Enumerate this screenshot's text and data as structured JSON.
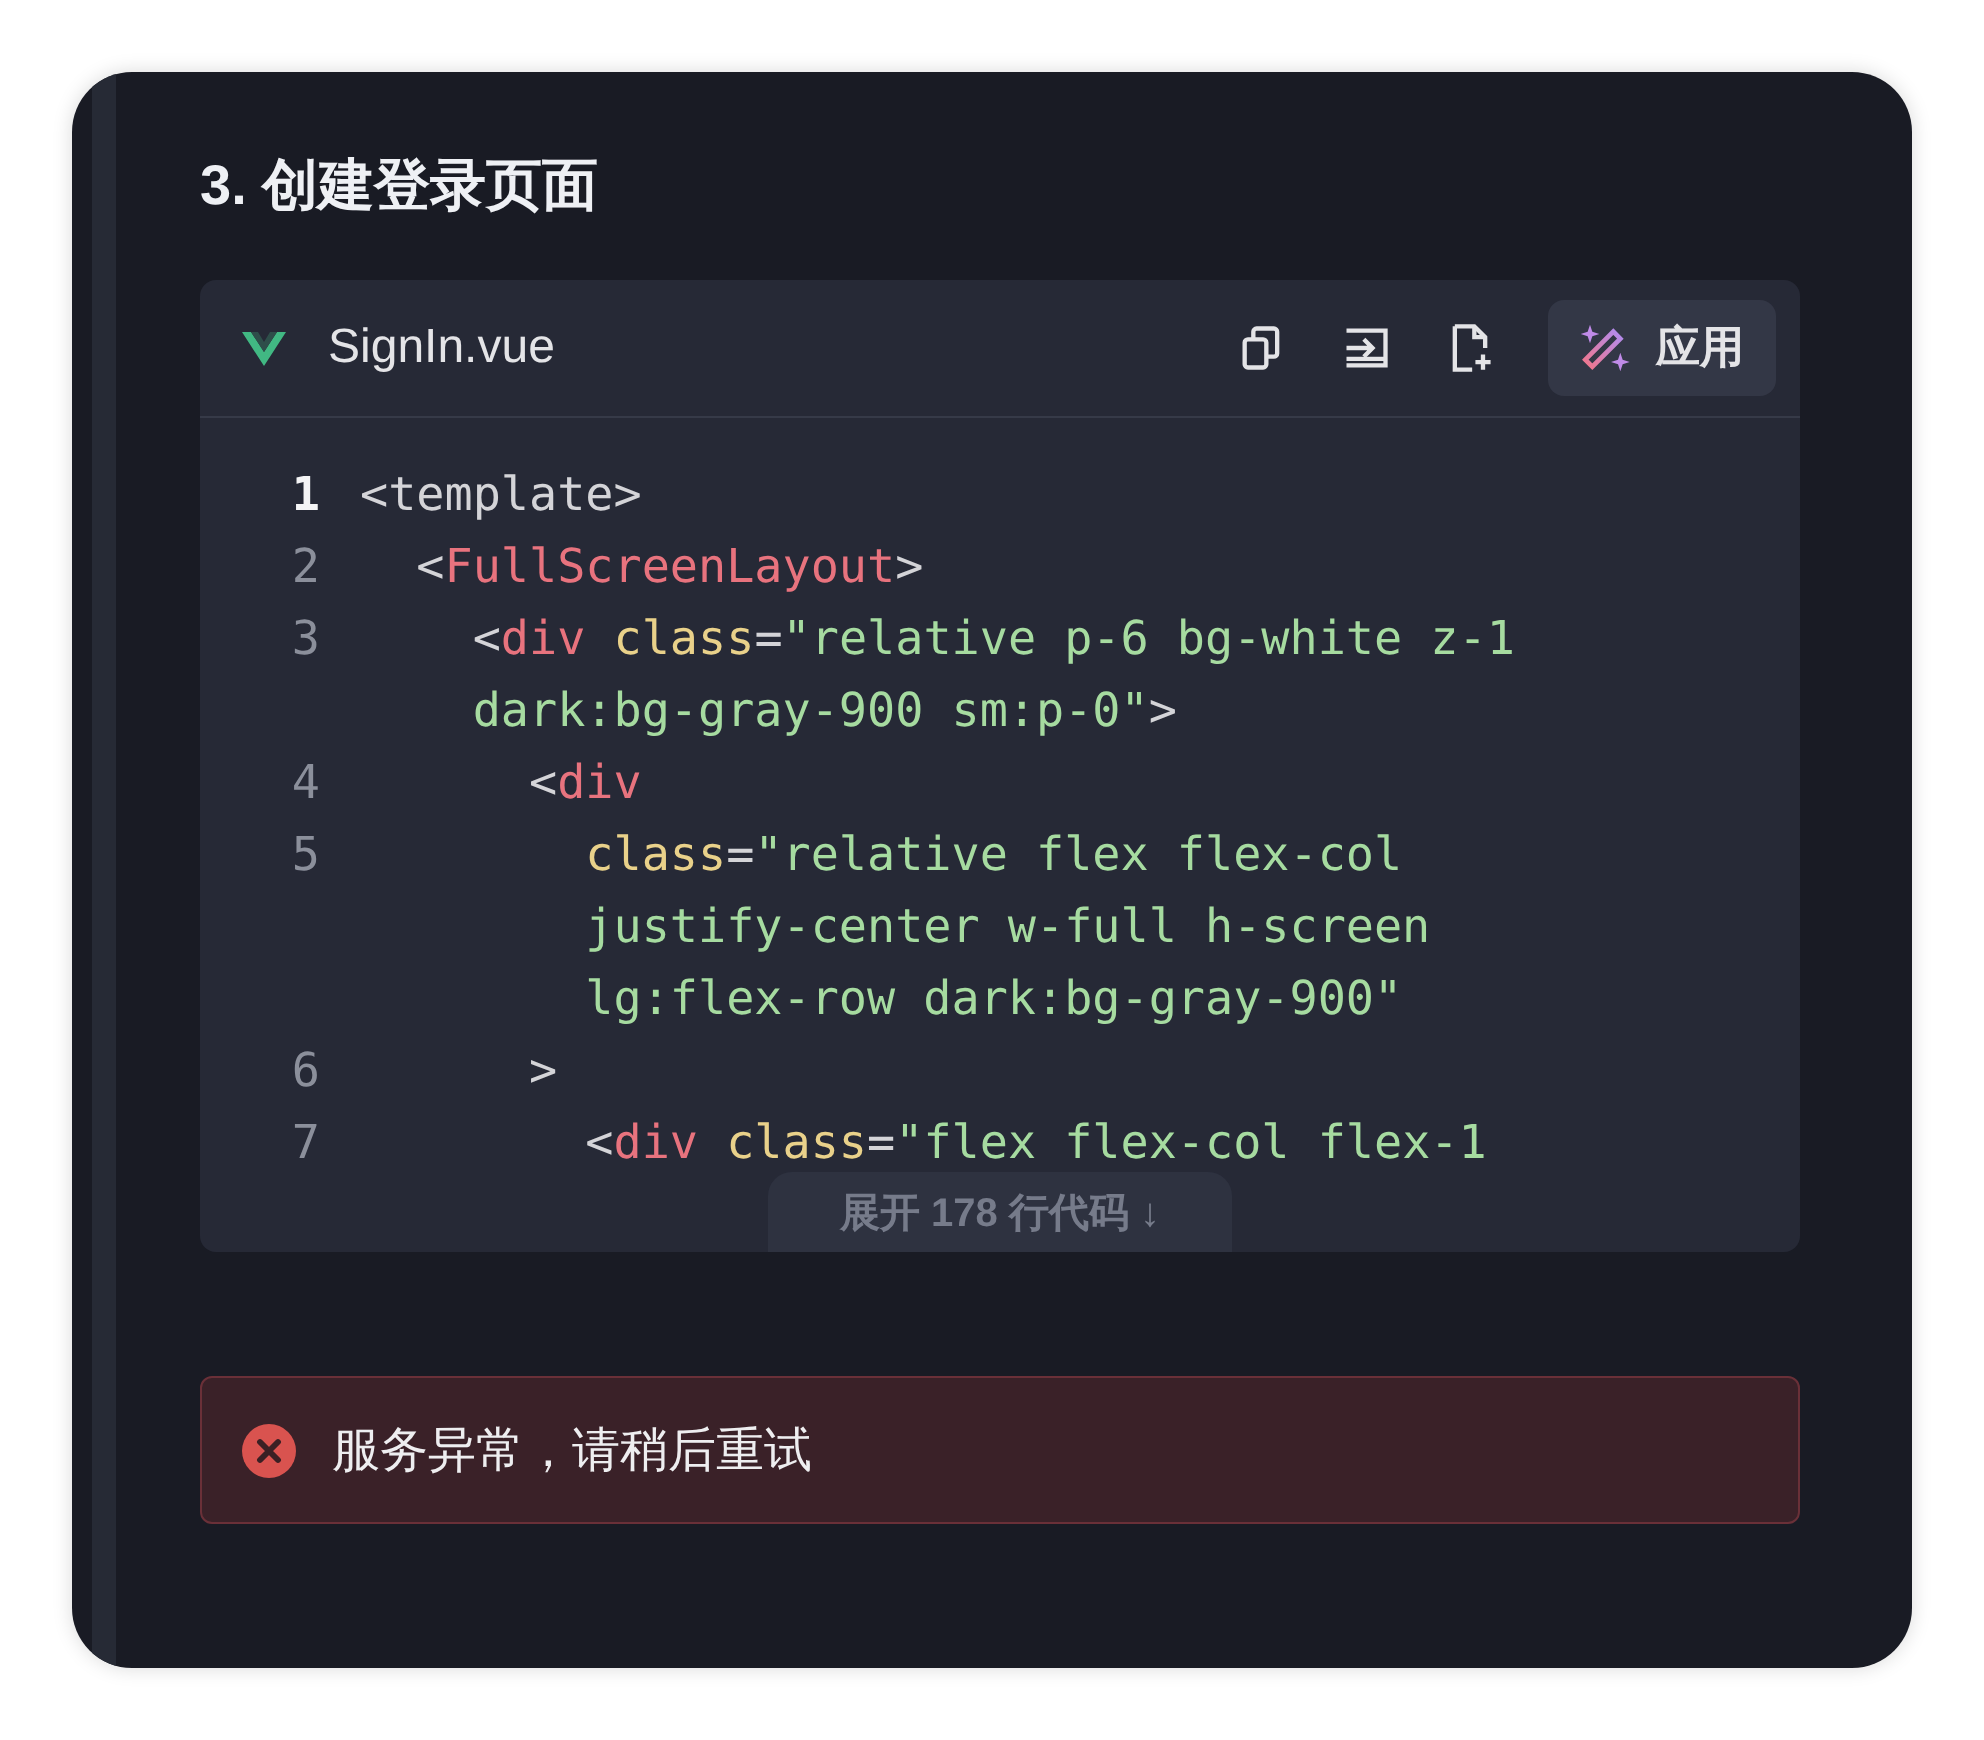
{
  "heading": "3. 创建登录页面",
  "code_block": {
    "filename": "SignIn.vue",
    "toolbar": [
      {
        "kind": "copy"
      },
      {
        "kind": "insert"
      },
      {
        "kind": "new-file"
      }
    ],
    "apply_button": "应用",
    "lines": [
      {
        "number": "1",
        "current": true,
        "rows": [
          [
            {
              "kind": "punct",
              "text": "<template>"
            }
          ]
        ]
      },
      {
        "number": "2",
        "current": false,
        "rows": [
          [
            {
              "kind": "punct",
              "text": "  <"
            },
            {
              "kind": "tag",
              "text": "FullScreenLayout"
            },
            {
              "kind": "punct",
              "text": ">"
            }
          ]
        ]
      },
      {
        "number": "3",
        "current": false,
        "rows": [
          [
            {
              "kind": "punct",
              "text": "    <"
            },
            {
              "kind": "tag",
              "text": "div"
            },
            {
              "kind": "punct",
              "text": " "
            },
            {
              "kind": "attr",
              "text": "class"
            },
            {
              "kind": "punct",
              "text": "="
            },
            {
              "kind": "string",
              "text": "\"relative p-6 bg-white z-1"
            }
          ],
          [
            {
              "kind": "punct",
              "text": "    "
            },
            {
              "kind": "string",
              "text": "dark:bg-gray-900 sm:p-0\""
            },
            {
              "kind": "punct",
              "text": ">"
            }
          ]
        ]
      },
      {
        "number": "4",
        "current": false,
        "rows": [
          [
            {
              "kind": "punct",
              "text": "      <"
            },
            {
              "kind": "tag",
              "text": "div"
            }
          ]
        ]
      },
      {
        "number": "5",
        "current": false,
        "rows": [
          [
            {
              "kind": "punct",
              "text": "        "
            },
            {
              "kind": "attr",
              "text": "class"
            },
            {
              "kind": "punct",
              "text": "="
            },
            {
              "kind": "string",
              "text": "\"relative flex flex-col"
            }
          ],
          [
            {
              "kind": "punct",
              "text": "        "
            },
            {
              "kind": "string",
              "text": "justify-center w-full h-screen"
            }
          ],
          [
            {
              "kind": "punct",
              "text": "        "
            },
            {
              "kind": "string",
              "text": "lg:flex-row dark:bg-gray-900\""
            }
          ]
        ]
      },
      {
        "number": "6",
        "current": false,
        "rows": [
          [
            {
              "kind": "punct",
              "text": "      >"
            }
          ]
        ]
      },
      {
        "number": "7",
        "current": false,
        "rows": [
          [
            {
              "kind": "punct",
              "text": "        <"
            },
            {
              "kind": "tag",
              "text": "div"
            },
            {
              "kind": "punct",
              "text": " "
            },
            {
              "kind": "attr",
              "text": "class"
            },
            {
              "kind": "punct",
              "text": "="
            },
            {
              "kind": "string",
              "text": "\"flex flex-col flex-1"
            }
          ]
        ]
      }
    ],
    "expand_button": "展开 178 行代码 ↓"
  },
  "error": {
    "message": "服务异常，请稍后重试"
  }
}
